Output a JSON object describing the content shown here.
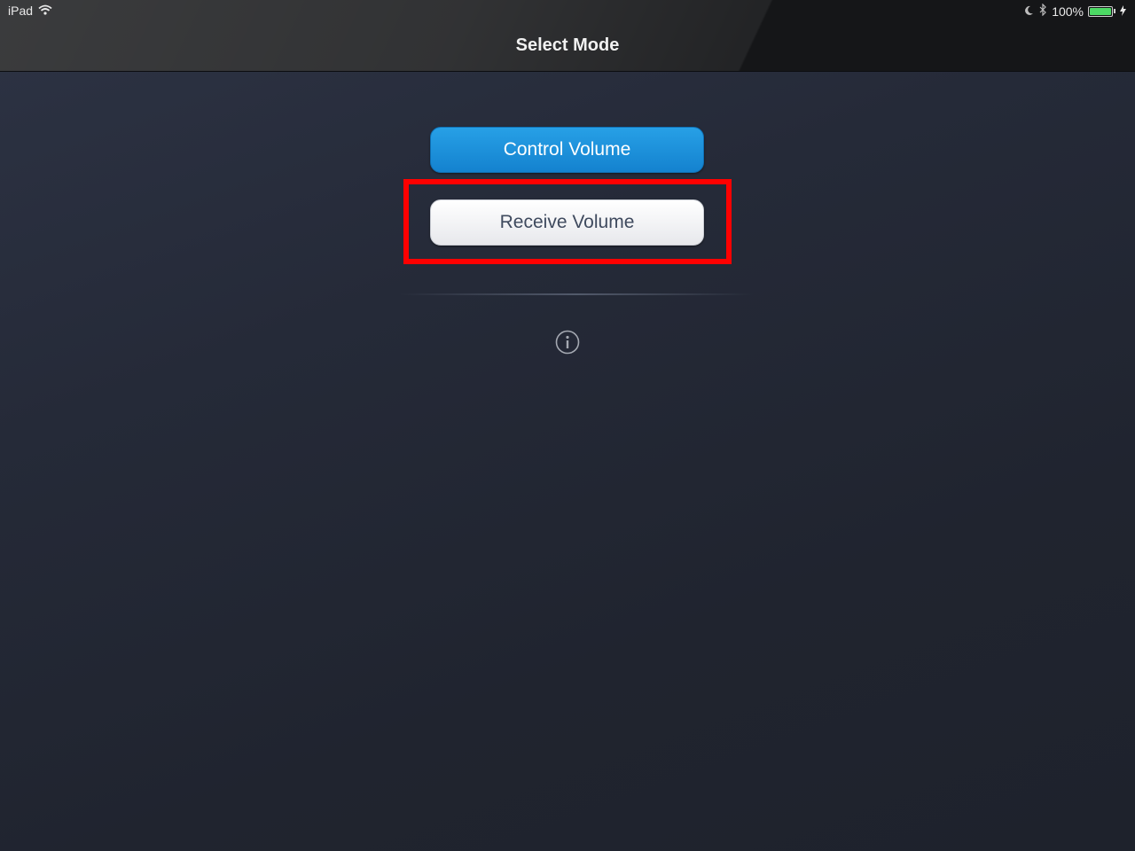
{
  "status_bar": {
    "device": "iPad",
    "wifi_icon": "wifi-icon",
    "moon_icon": "moon-icon",
    "bluetooth_icon": "bluetooth-icon",
    "battery_percent": "100%",
    "battery_level": 1.0,
    "charging_icon": "bolt-icon"
  },
  "nav": {
    "title": "Select Mode"
  },
  "buttons": {
    "control_volume": "Control Volume",
    "receive_volume": "Receive Volume"
  },
  "info_icon": "info-icon",
  "colors": {
    "primary_button": "#1a8fdc",
    "highlight_box": "#ff0000",
    "battery": "#4cd964"
  }
}
